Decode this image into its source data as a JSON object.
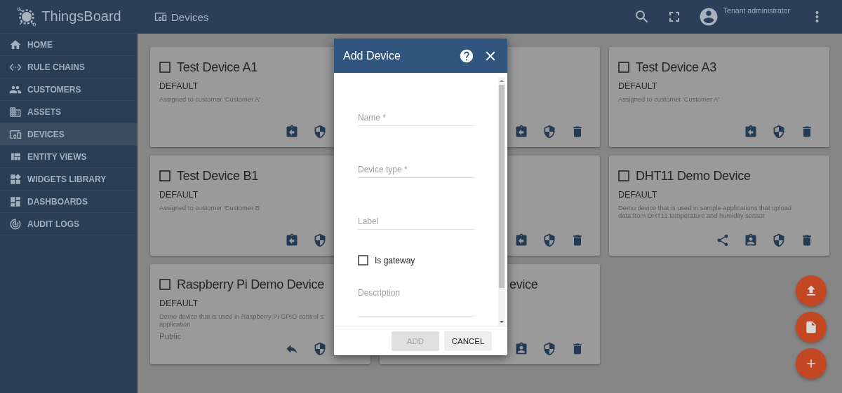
{
  "app": {
    "name": "ThingsBoard"
  },
  "sidebar": {
    "items": [
      {
        "label": "HOME",
        "selected": false
      },
      {
        "label": "RULE CHAINS",
        "selected": false
      },
      {
        "label": "CUSTOMERS",
        "selected": false
      },
      {
        "label": "ASSETS",
        "selected": false
      },
      {
        "label": "DEVICES",
        "selected": true
      },
      {
        "label": "ENTITY VIEWS",
        "selected": false
      },
      {
        "label": "WIDGETS LIBRARY",
        "selected": false
      },
      {
        "label": "DASHBOARDS",
        "selected": false
      },
      {
        "label": "AUDIT LOGS",
        "selected": false
      }
    ]
  },
  "toolbar": {
    "title": "Devices",
    "user": "Tenant administrator"
  },
  "cards": [
    {
      "title": "Test Device A1",
      "checked": false,
      "type": "DEFAULT",
      "description": [
        "Assigned to customer 'Customer A'"
      ],
      "actions": [
        {
          "kind": "unassign"
        },
        {
          "kind": "credentials"
        }
      ]
    },
    {
      "actions": [
        {
          "kind": "unassign"
        },
        {
          "kind": "credentials"
        },
        {
          "kind": "delete"
        }
      ]
    },
    {
      "title": "Test Device A3",
      "checked": false,
      "type": "DEFAULT",
      "description": [
        "Assigned to customer 'Customer A'"
      ],
      "actions": [
        {
          "kind": "unassign"
        },
        {
          "kind": "credentials"
        },
        {
          "kind": "delete"
        }
      ]
    },
    {
      "title": "Test Device B1",
      "checked": false,
      "type": "DEFAULT",
      "description": [
        "Assigned to customer 'Customer B'"
      ],
      "actions": [
        {
          "kind": "unassign"
        },
        {
          "kind": "credentials"
        }
      ]
    },
    {
      "actions": [
        {
          "kind": "unassign"
        },
        {
          "kind": "credentials"
        },
        {
          "kind": "delete"
        }
      ]
    },
    {
      "title": "DHT11 Demo Device",
      "checked": false,
      "type": "DEFAULT",
      "description": [
        "Demo device that is used in sample applications that upload",
        "data from DHT11 temperature and humidity sensor"
      ],
      "actions": [
        {
          "kind": "share"
        },
        {
          "kind": "assign"
        },
        {
          "kind": "credentials"
        },
        {
          "kind": "delete"
        }
      ]
    },
    {
      "title": "Raspberry Pi Demo Device",
      "checked": false,
      "type": "DEFAULT",
      "description": [
        "Demo device that is used in Raspberry Pi GPIO control s",
        "application"
      ],
      "visibility": "Public",
      "actions": [
        {
          "kind": "make-private"
        },
        {
          "kind": "credentials"
        }
      ]
    },
    {
      "title": "evice",
      "actions": [
        {
          "kind": "assign"
        },
        {
          "kind": "credentials"
        },
        {
          "kind": "delete"
        }
      ]
    }
  ],
  "fabs": [
    {
      "kind": "import"
    },
    {
      "kind": "file"
    },
    {
      "kind": "add"
    }
  ],
  "dialog": {
    "title": "Add Device",
    "fields": [
      {
        "kind": "text",
        "placeholder": "Name *"
      },
      {
        "kind": "text",
        "placeholder": "Device type *"
      },
      {
        "kind": "text",
        "placeholder": "Label"
      },
      {
        "kind": "checkbox",
        "label": "Is gateway",
        "checked": false
      },
      {
        "kind": "textarea",
        "placeholder": "Description"
      }
    ],
    "buttons": [
      {
        "label": "ADD",
        "disabled": true
      },
      {
        "label": "CANCEL",
        "disabled": false
      }
    ]
  }
}
